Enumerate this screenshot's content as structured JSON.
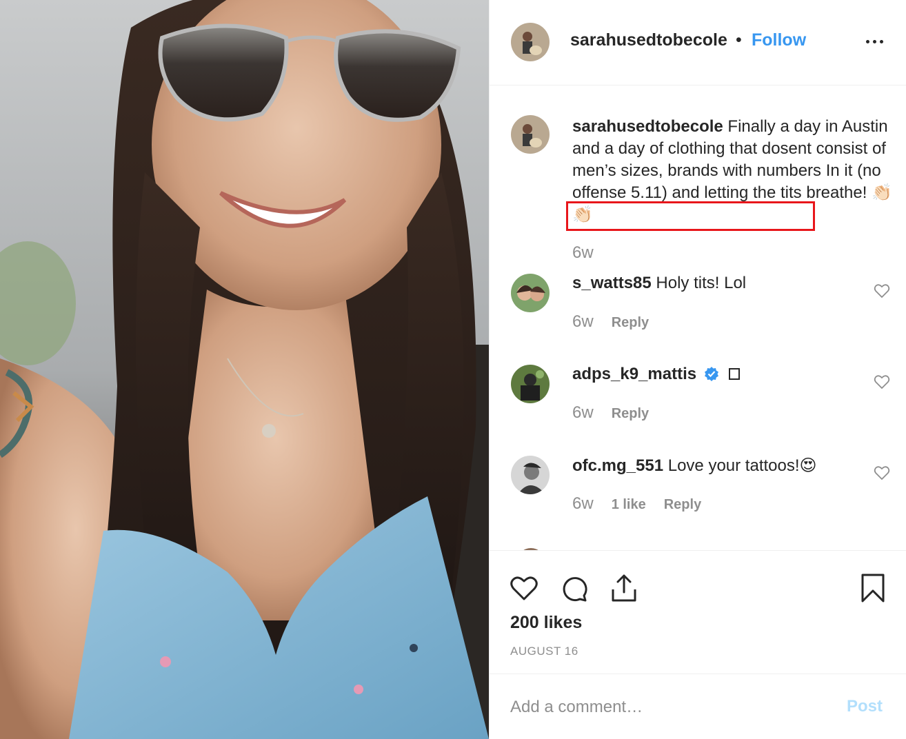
{
  "post": {
    "username": "sarahusedtobecole",
    "separator": "•",
    "follow_label": "Follow",
    "more_icon": "more-horizontal-icon"
  },
  "caption": {
    "username": "sarahusedtobecole",
    "text": "Finally a day in Austin and a day of clothing that dosent consist of men’s sizes, brands with numbers In it (no offense 5.11) and letting the tits breathe! 👏🏻👏🏻",
    "time": "6w",
    "highlight_color": "#e8161b"
  },
  "comments": [
    {
      "username": "s_watts85",
      "text": "Holy tits! Lol",
      "time": "6w",
      "likes": "",
      "reply_label": "Reply"
    },
    {
      "username": "adps_k9_mattis",
      "text": "",
      "time": "6w",
      "likes": "",
      "reply_label": "Reply",
      "verified": true
    },
    {
      "username": "ofc.mg_551",
      "text": "Love your tattoos!😍",
      "time": "6w",
      "likes": "1 like",
      "reply_label": "Reply"
    }
  ],
  "actions": {
    "likes_label": "200 likes",
    "date": "AUGUST 16"
  },
  "composer": {
    "placeholder": "Add a comment…",
    "post_label": "Post"
  },
  "colors": {
    "link_blue": "#3897f0",
    "post_disabled": "#b2dffc",
    "muted_text": "#8e8e8e",
    "primary_text": "#262626"
  }
}
